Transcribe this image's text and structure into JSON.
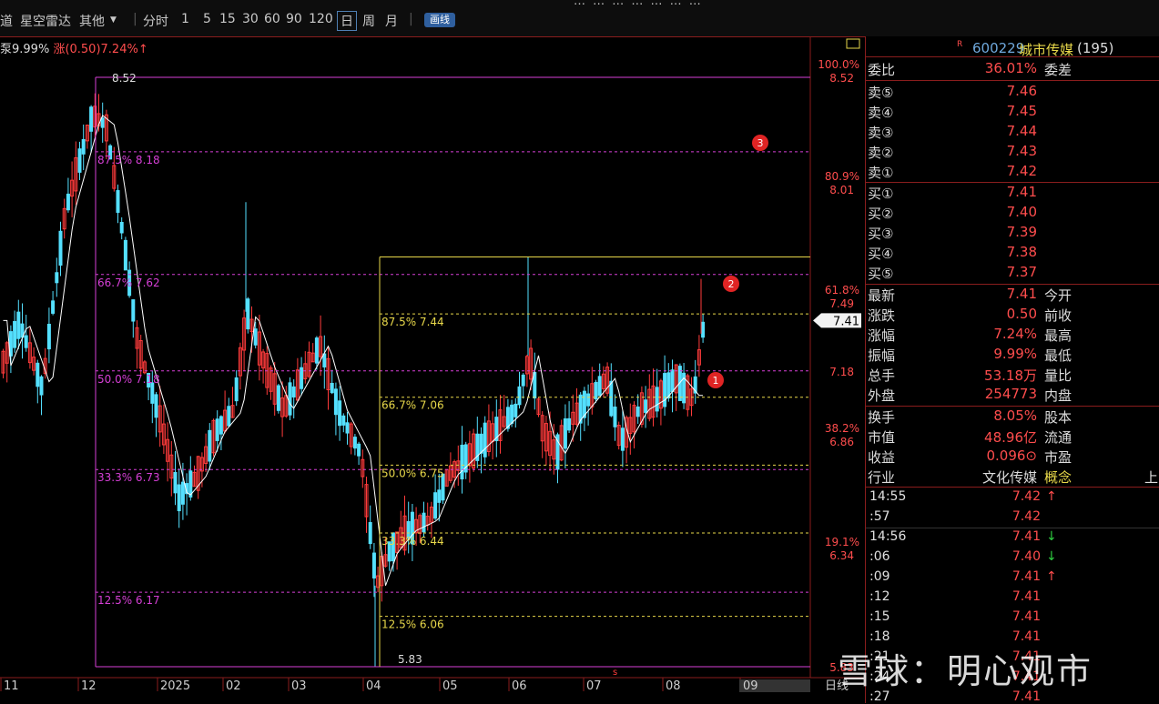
{
  "toolbar": {
    "items": [
      {
        "label": "道"
      },
      {
        "label": "星空雷达"
      },
      {
        "label": "其他"
      },
      {
        "label": "分时"
      },
      {
        "label": "1"
      },
      {
        "label": "5"
      },
      {
        "label": "15"
      },
      {
        "label": "30"
      },
      {
        "label": "60"
      },
      {
        "label": "90"
      },
      {
        "label": "120"
      },
      {
        "label": "日"
      },
      {
        "label": "周"
      },
      {
        "label": "月"
      }
    ],
    "draw_btn": "画线",
    "selected": "日"
  },
  "info_line": {
    "left": "9.99%",
    "change": "涨(0.50)7.24%↑"
  },
  "chart_data": {
    "type": "candlestick",
    "x_ticks": [
      "11",
      "12",
      "2025",
      "02",
      "03",
      "04",
      "05",
      "06",
      "07",
      "08",
      "09"
    ],
    "period_label": "日线",
    "price_range": [
      5.83,
      8.52
    ],
    "high_label": "8.52",
    "low_label": "5.83",
    "fib_left": [
      {
        "label": "87.5% 8.18",
        "price": 8.18
      },
      {
        "label": "66.7% 7.62",
        "price": 7.62
      },
      {
        "label": "50.0% 7.18",
        "price": 7.18
      },
      {
        "label": "33.3% 6.73",
        "price": 6.73
      },
      {
        "label": "12.5% 6.17",
        "price": 6.17
      }
    ],
    "fib_right": [
      {
        "label": "87.5% 7.44",
        "price": 7.44
      },
      {
        "label": "66.7% 7.06",
        "price": 7.06
      },
      {
        "label": "50.0% 6.75",
        "price": 6.75
      },
      {
        "label": "33.3% 6.44",
        "price": 6.44
      },
      {
        "label": "12.5% 6.06",
        "price": 6.06
      }
    ],
    "axis_labels": [
      {
        "pct": "100.0%",
        "price": "8.52",
        "value": 8.52
      },
      {
        "pct": "80.9%",
        "price": "8.01",
        "value": 8.01
      },
      {
        "pct": "61.8%",
        "price": "7.49",
        "value": 7.49
      },
      {
        "pct": "",
        "price": "7.18",
        "value": 7.18
      },
      {
        "pct": "38.2%",
        "price": "6.86",
        "value": 6.86
      },
      {
        "pct": "19.1%",
        "price": "6.34",
        "value": 6.34
      },
      {
        "pct": "",
        "price": "5.83",
        "value": 5.83
      }
    ],
    "current_price": "7.41",
    "markers": [
      "1",
      "2",
      "3"
    ],
    "colors": {
      "up": "#ff3b3b",
      "down": "#54e0ff",
      "ma": "#ffffff",
      "fib_left": "#d63fd6",
      "fib_right": "#e8d84a"
    }
  },
  "quote": {
    "code": "600229",
    "name": "城市传媒",
    "count": "(195)",
    "r_mark": "R",
    "wb_label": "委比",
    "wb_value": "36.01%",
    "wc_label": "委差",
    "sells": [
      {
        "label": "卖⑤",
        "price": "7.46"
      },
      {
        "label": "卖④",
        "price": "7.45"
      },
      {
        "label": "卖③",
        "price": "7.44"
      },
      {
        "label": "卖②",
        "price": "7.43"
      },
      {
        "label": "卖①",
        "price": "7.42"
      }
    ],
    "buys": [
      {
        "label": "买①",
        "price": "7.41"
      },
      {
        "label": "买②",
        "price": "7.40"
      },
      {
        "label": "买③",
        "price": "7.39"
      },
      {
        "label": "买④",
        "price": "7.38"
      },
      {
        "label": "买⑤",
        "price": "7.37"
      }
    ],
    "stats": [
      {
        "l": "最新",
        "v": "7.41",
        "r": "今开"
      },
      {
        "l": "涨跌",
        "v": "0.50",
        "r": "前收"
      },
      {
        "l": "涨幅",
        "v": "7.24%",
        "r": "最高"
      },
      {
        "l": "振幅",
        "v": "9.99%",
        "r": "最低"
      },
      {
        "l": "总手",
        "v": "53.18万",
        "r": "量比"
      },
      {
        "l": "外盘",
        "v": "254773",
        "r": "内盘"
      }
    ],
    "stats2": [
      {
        "l": "换手",
        "v": "8.05%",
        "r": "股本"
      },
      {
        "l": "市值",
        "v": "48.96亿",
        "r": "流通"
      },
      {
        "l": "收益",
        "v": "0.096⊙",
        "r": "市盈"
      },
      {
        "l": "行业",
        "v": "文化传媒",
        "r": "概念"
      }
    ],
    "extra": "上"
  },
  "ticks": [
    {
      "t": "14:55",
      "p": "7.42",
      "a": "↑"
    },
    {
      "t": ":57",
      "p": "7.42",
      "a": ""
    },
    {
      "t": "14:56",
      "p": "7.41",
      "a": "↓"
    },
    {
      "t": ":06",
      "p": "7.40",
      "a": "↓"
    },
    {
      "t": ":09",
      "p": "7.41",
      "a": "↑"
    },
    {
      "t": ":12",
      "p": "7.41",
      "a": ""
    },
    {
      "t": ":15",
      "p": "7.41",
      "a": ""
    },
    {
      "t": ":18",
      "p": "7.41",
      "a": ""
    },
    {
      "t": ":21",
      "p": "7.41",
      "a": ""
    },
    {
      "t": ":24",
      "p": "7.41",
      "a": ""
    },
    {
      "t": ":27",
      "p": "7.41",
      "a": ""
    }
  ],
  "watermark": "雪球：明心观市"
}
